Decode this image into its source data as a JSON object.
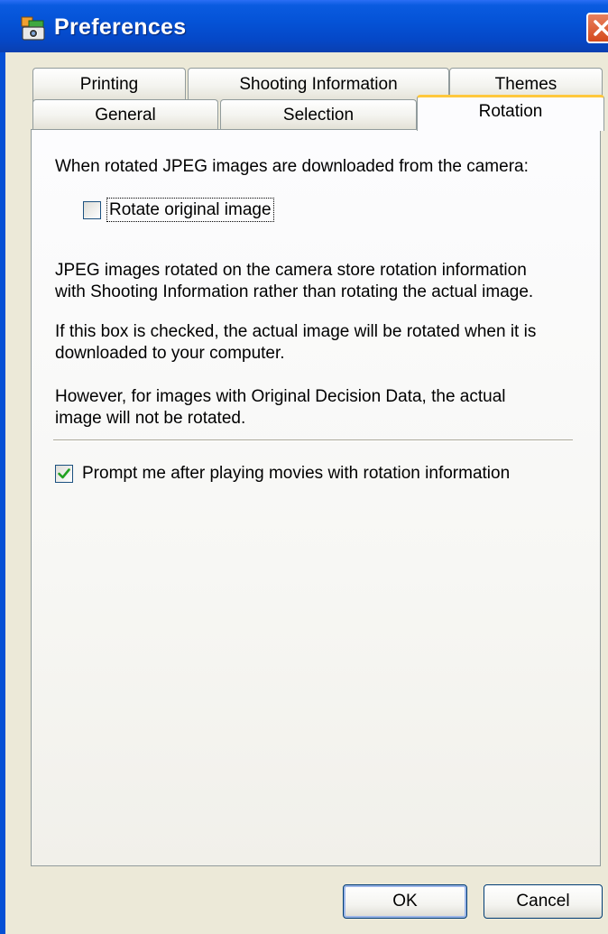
{
  "window": {
    "title": "Preferences"
  },
  "tabs": {
    "row1": [
      {
        "label": "Printing"
      },
      {
        "label": "Shooting Information"
      },
      {
        "label": "Themes"
      }
    ],
    "row2": [
      {
        "label": "General"
      },
      {
        "label": "Selection"
      },
      {
        "label": "Rotation",
        "active": true
      }
    ]
  },
  "rotation": {
    "heading": "When rotated JPEG images are downloaded from the camera:",
    "rotate_checkbox": {
      "label": "Rotate original image",
      "checked": false
    },
    "para1": [
      "JPEG images rotated on the camera store rotation information",
      "with Shooting Information rather than rotating the actual image."
    ],
    "para2": [
      "If this box is checked, the actual image will be rotated when it is",
      "downloaded to your computer."
    ],
    "para3": [
      "However, for images with Original Decision Data, the actual",
      "image will not be rotated."
    ],
    "prompt_checkbox": {
      "label": "Prompt me after playing movies with rotation information",
      "checked": true
    }
  },
  "buttons": {
    "ok": "OK",
    "cancel": "Cancel"
  },
  "colors": {
    "titlebar": "#0553d7",
    "tab_active_accent": "#ffc83c",
    "checkmark": "#21a121",
    "dialog_bg": "#ece9d8"
  }
}
